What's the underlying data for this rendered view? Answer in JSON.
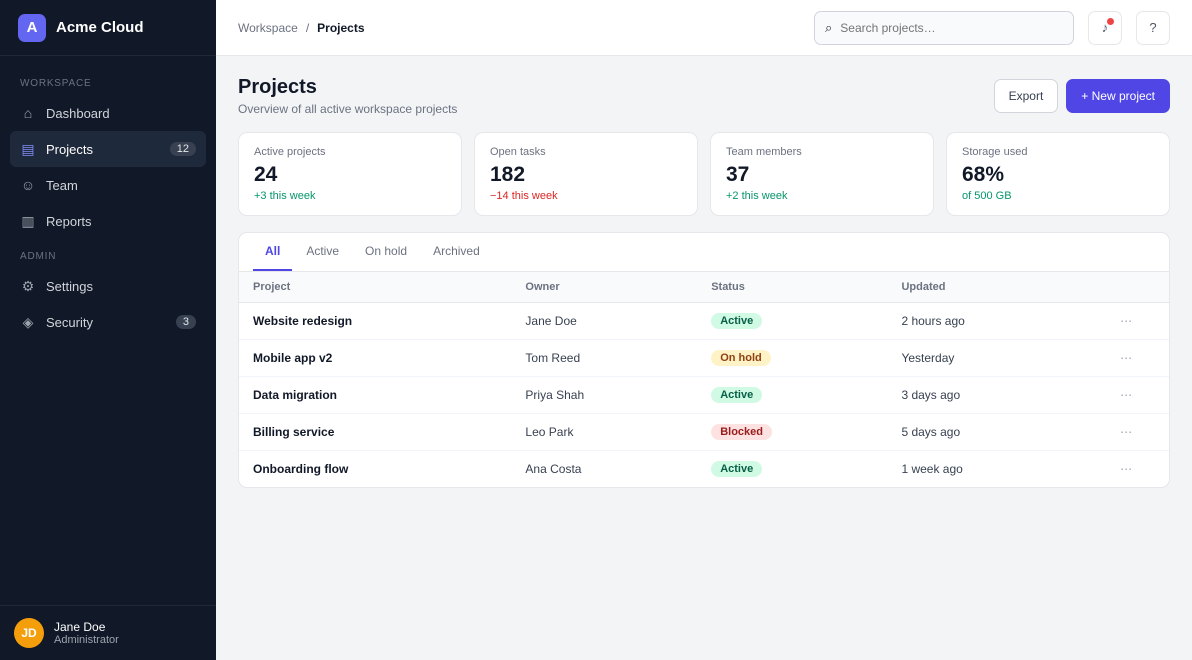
{
  "brand": {
    "logo_letter": "A",
    "name": "Acme Cloud"
  },
  "sidebar": {
    "section_main": "Workspace",
    "section_admin": "Admin",
    "items_main": [
      {
        "icon": "home-icon",
        "glyph": "⌂",
        "label": "Dashboard",
        "badge": ""
      },
      {
        "icon": "folder-icon",
        "glyph": "▤",
        "label": "Projects",
        "badge": "12"
      },
      {
        "icon": "users-icon",
        "glyph": "☺",
        "label": "Team",
        "badge": ""
      },
      {
        "icon": "chart-icon",
        "glyph": "▥",
        "label": "Reports",
        "badge": ""
      }
    ],
    "items_admin": [
      {
        "icon": "gear-icon",
        "glyph": "⚙",
        "label": "Settings",
        "badge": ""
      },
      {
        "icon": "shield-icon",
        "glyph": "◈",
        "label": "Security",
        "badge": "3"
      }
    ],
    "user": {
      "initials": "JD",
      "name": "Jane Doe",
      "role": "Administrator"
    }
  },
  "topbar": {
    "crumb_root": "Workspace",
    "crumb_sep": "/",
    "crumb_current": "Projects",
    "search_placeholder": "Search projects…",
    "search_icon": "search-icon",
    "bell_icon": "bell-icon",
    "help_icon": "help-icon"
  },
  "page": {
    "title": "Projects",
    "subtitle": "Overview of all active workspace projects",
    "export_label": "Export",
    "new_label": "+ New project"
  },
  "stats": [
    {
      "label": "Active projects",
      "value": "24",
      "delta": "+3 this week",
      "trend": "up"
    },
    {
      "label": "Open tasks",
      "value": "182",
      "delta": "−14 this week",
      "trend": "down"
    },
    {
      "label": "Team members",
      "value": "37",
      "delta": "+2 this week",
      "trend": "up"
    },
    {
      "label": "Storage used",
      "value": "68%",
      "delta": "of 500 GB",
      "trend": "up"
    }
  ],
  "tabs": [
    "All",
    "Active",
    "On hold",
    "Archived"
  ],
  "table": {
    "headers": [
      "Project",
      "Owner",
      "Status",
      "Updated",
      ""
    ],
    "rows": [
      {
        "name": "Website redesign",
        "owner": "Jane Doe",
        "status": "Active",
        "kind": "ok",
        "updated": "2 hours ago"
      },
      {
        "name": "Mobile app v2",
        "owner": "Tom Reed",
        "status": "On hold",
        "kind": "warn",
        "updated": "Yesterday"
      },
      {
        "name": "Data migration",
        "owner": "Priya Shah",
        "status": "Active",
        "kind": "ok",
        "updated": "3 days ago"
      },
      {
        "name": "Billing service",
        "owner": "Leo Park",
        "status": "Blocked",
        "kind": "bad",
        "updated": "5 days ago"
      },
      {
        "name": "Onboarding flow",
        "owner": "Ana Costa",
        "status": "Active",
        "kind": "ok",
        "updated": "1 week ago"
      }
    ]
  }
}
